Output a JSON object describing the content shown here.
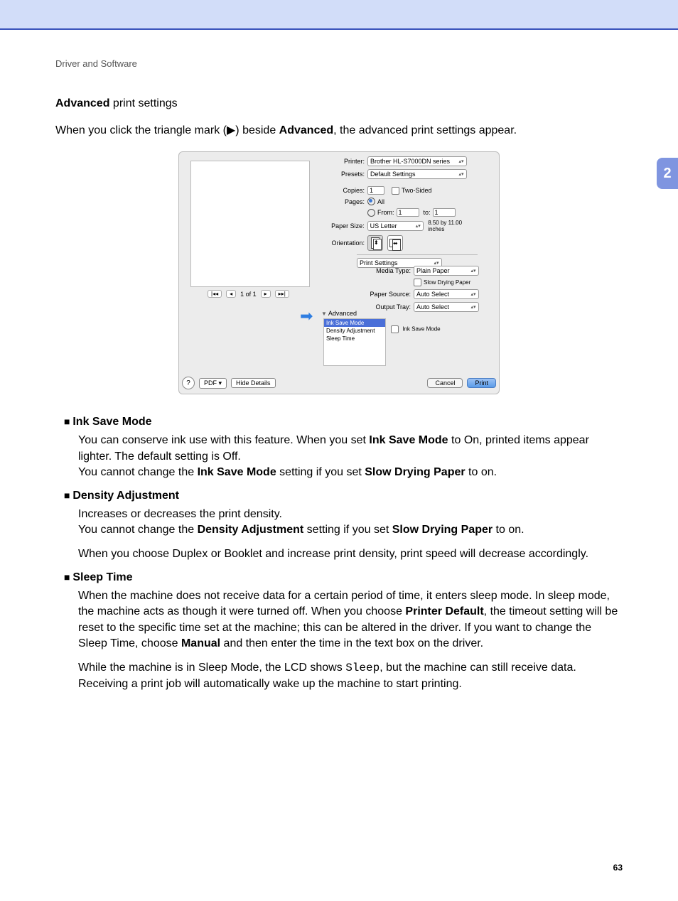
{
  "breadcrumb": "Driver and Software",
  "section_tab": "2",
  "title_bold": "Advanced",
  "title_rest": " print settings",
  "intro_a": "When you click the triangle mark (",
  "intro_tri": "▶",
  "intro_b": ") beside ",
  "intro_bold": "Advanced",
  "intro_c": ", the advanced print settings appear.",
  "dialog": {
    "printer_label": "Printer:",
    "printer_value": "Brother HL-S7000DN series",
    "presets_label": "Presets:",
    "presets_value": "Default Settings",
    "copies_label": "Copies:",
    "copies_value": "1",
    "two_sided": "Two-Sided",
    "pages_label": "Pages:",
    "pages_all": "All",
    "pages_from": "From:",
    "pages_from_v": "1",
    "pages_to": "to:",
    "pages_to_v": "1",
    "paper_size_label": "Paper Size:",
    "paper_size_value": "US Letter",
    "paper_dims": "8.50 by 11.00 inches",
    "orientation_label": "Orientation:",
    "section_dropdown": "Print Settings",
    "media_type_label": "Media Type:",
    "media_type_value": "Plain Paper",
    "slow_drying": "Slow Drying Paper",
    "paper_source_label": "Paper Source:",
    "paper_source_value": "Auto Select",
    "output_tray_label": "Output Tray:",
    "output_tray_value": "Auto Select",
    "advanced_toggle": "Advanced",
    "adv_items": {
      "a": "Ink Save Mode",
      "b": "Density Adjustment",
      "c": "Sleep Time"
    },
    "ink_save_check": "Ink Save Mode",
    "nav_count": "1 of 1",
    "help": "?",
    "pdf": "PDF ▾",
    "hide": "Hide Details",
    "cancel": "Cancel",
    "print": "Print"
  },
  "b1_title": "Ink Save Mode",
  "b1_p1a": "You can conserve ink use with this feature. When you set ",
  "b1_p1b": "Ink Save Mode",
  "b1_p1c": " to On, printed items appear lighter. The default setting is Off.",
  "b1_p2a": "You cannot change the ",
  "b1_p2b": "Ink Save Mode",
  "b1_p2c": " setting if you set ",
  "b1_p2d": "Slow Drying Paper",
  "b1_p2e": " to on.",
  "b2_title": "Density Adjustment",
  "b2_p1": "Increases or decreases the print density.",
  "b2_p2a": "You cannot change the ",
  "b2_p2b": "Density Adjustment",
  "b2_p2c": " setting if you set ",
  "b2_p2d": "Slow Drying Paper",
  "b2_p2e": " to on.",
  "b2_p3": "When you choose Duplex or Booklet and increase print density, print speed will decrease accordingly.",
  "b3_title": "Sleep Time",
  "b3_p1a": "When the machine does not receive data for a certain period of time, it enters sleep mode. In sleep mode, the machine acts as though it were turned off. When you choose ",
  "b3_p1b": "Printer Default",
  "b3_p1c": ", the timeout setting will be reset to the specific time set at the machine; this can be altered in the driver. If you want to change the Sleep Time, choose ",
  "b3_p1d": "Manual",
  "b3_p1e": " and then enter the time in the text box on the driver.",
  "b3_p2a": "While the machine is in Sleep Mode, the LCD shows ",
  "b3_p2b": "Sleep",
  "b3_p2c": ", but the machine can still receive data. Receiving a print job will automatically wake up the machine to start printing.",
  "page_num": "63"
}
